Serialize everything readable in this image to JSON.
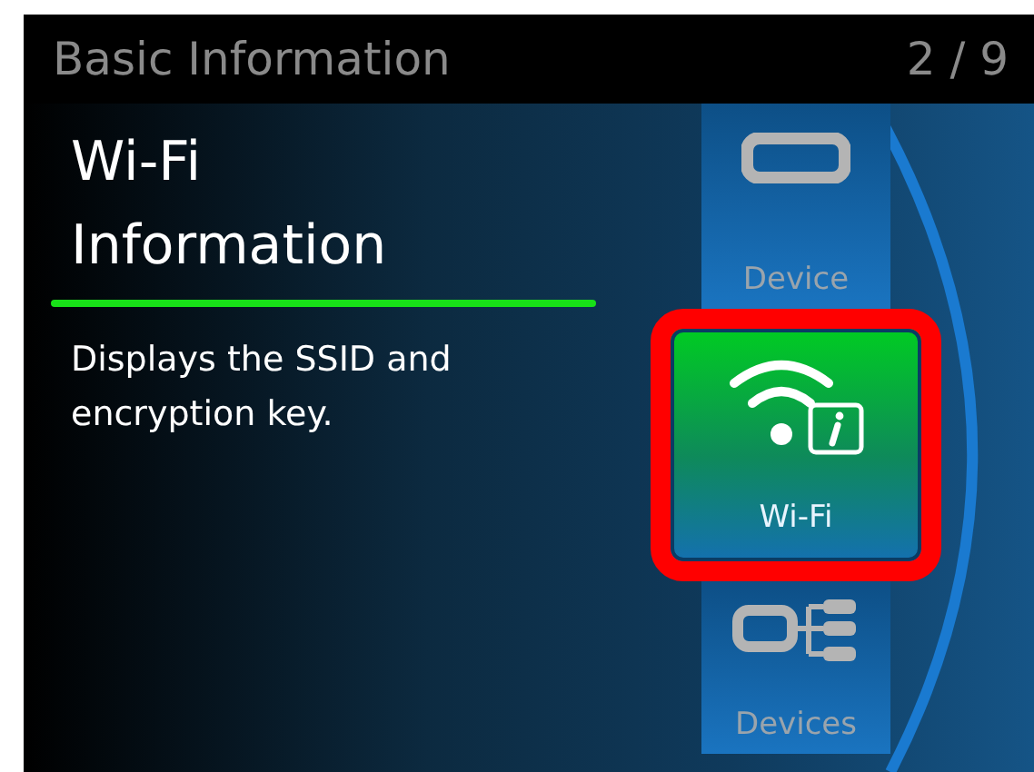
{
  "header": {
    "title": "Basic Information",
    "page": "2 / 9"
  },
  "detail": {
    "title_lines": [
      "Wi-Fi",
      "Information"
    ],
    "description": "Displays the SSID and encryption key."
  },
  "menu": [
    {
      "kind": "device",
      "label": "Device",
      "selected": false
    },
    {
      "kind": "wifi",
      "label": "Wi-Fi",
      "selected": true
    },
    {
      "kind": "devices",
      "label": "Devices",
      "selected": false
    }
  ]
}
